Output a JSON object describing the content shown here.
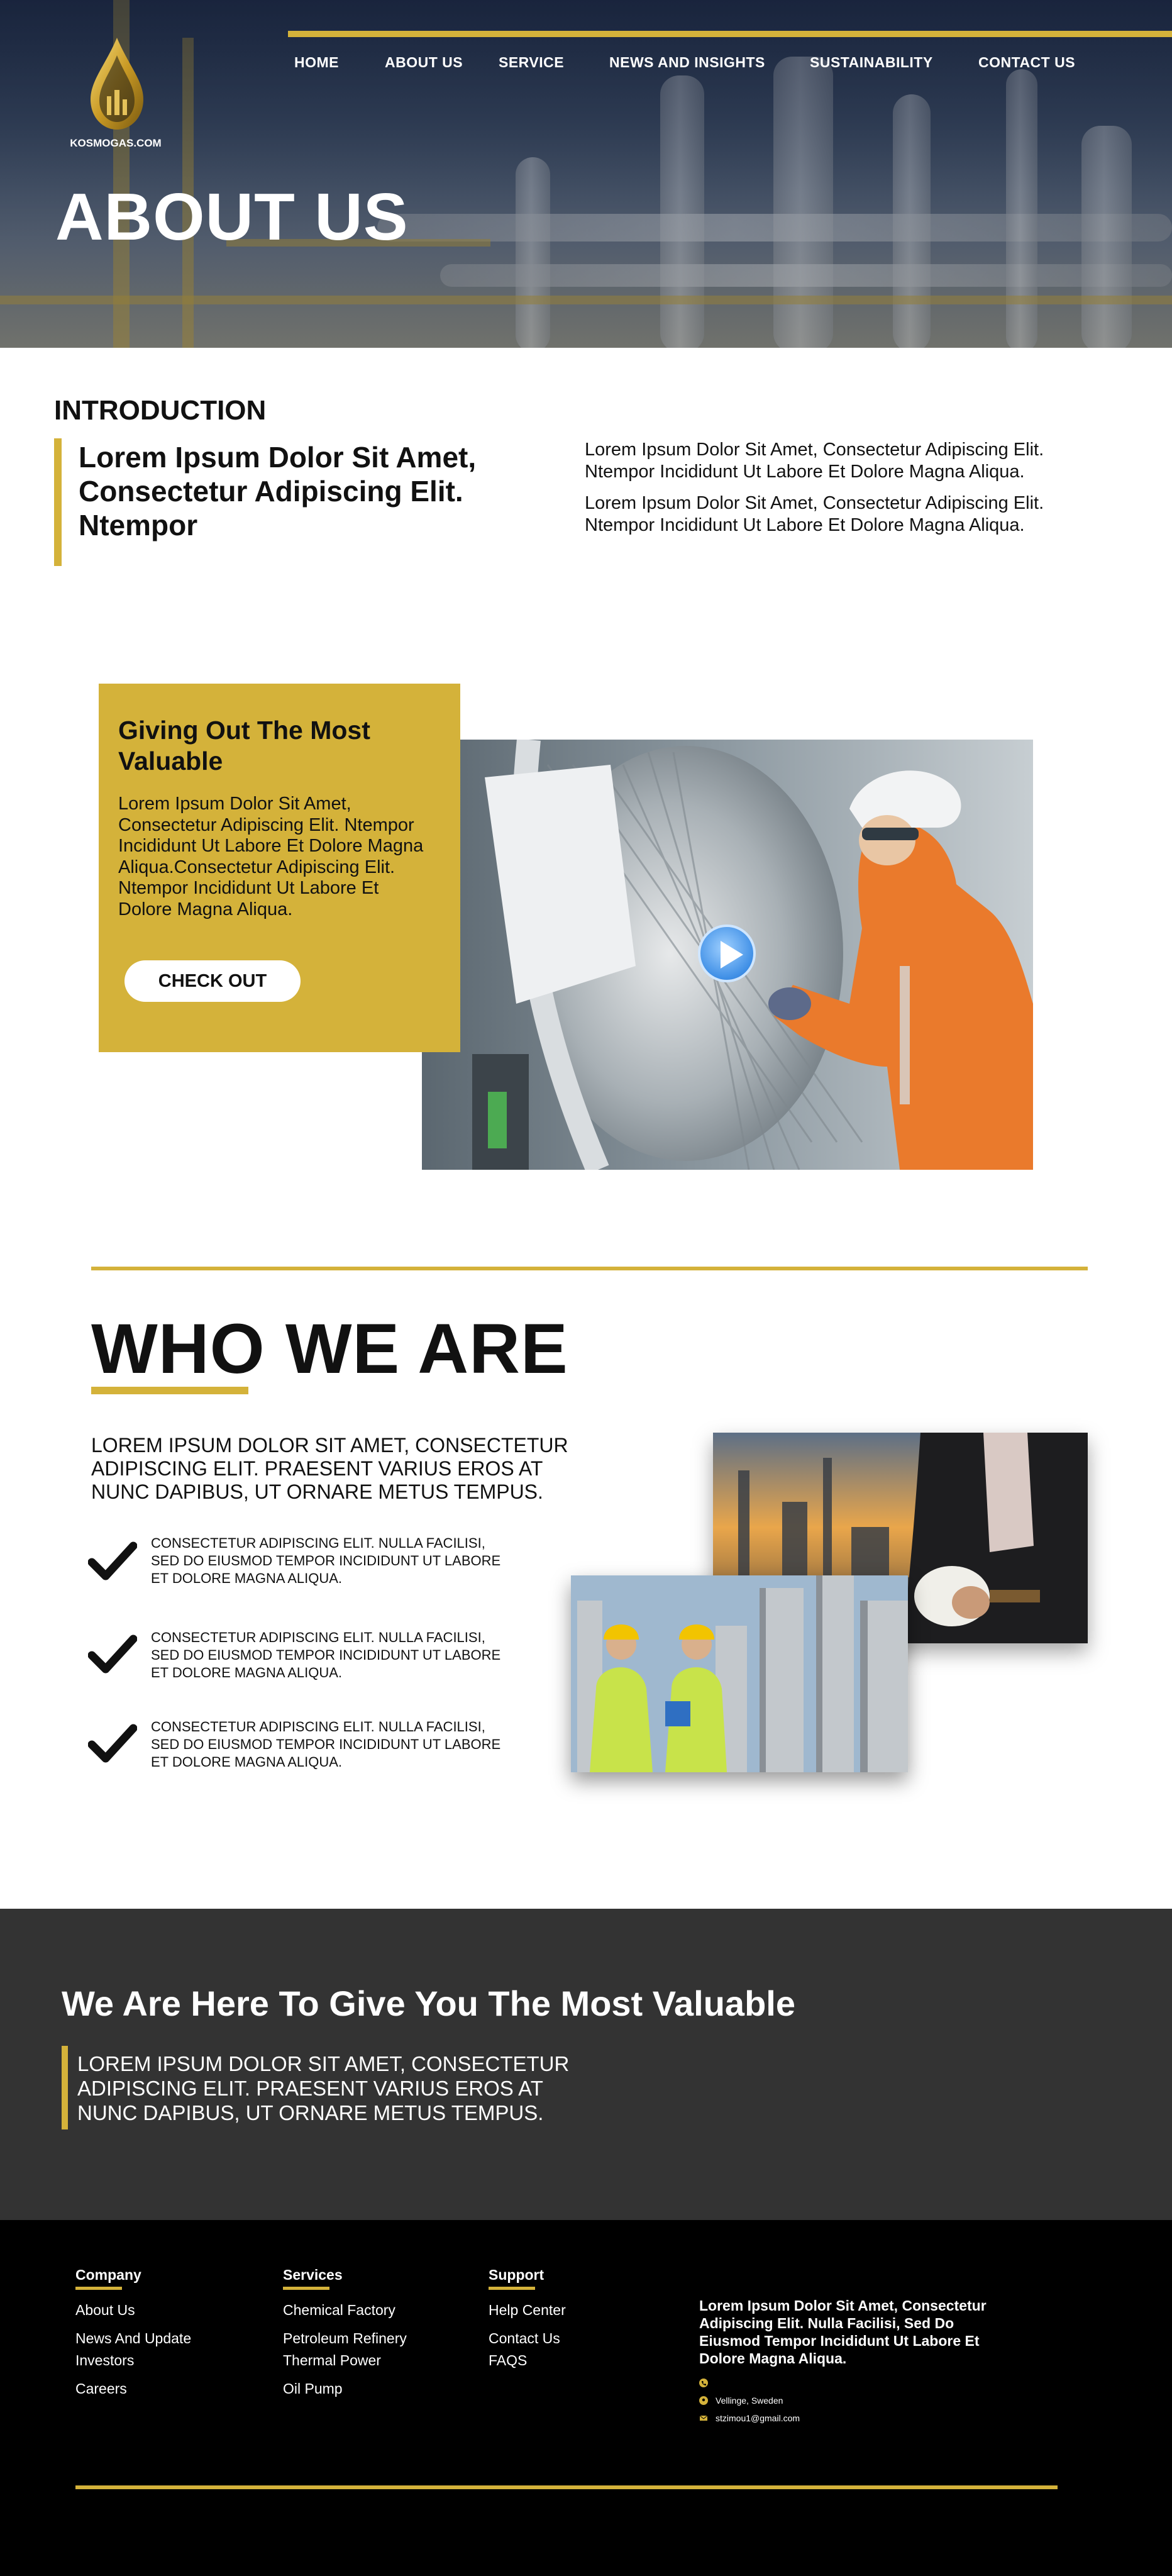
{
  "colors": {
    "accent": "#d4b23a",
    "dark_band": "#333333",
    "footer": "#000000"
  },
  "brand": {
    "name": "KOSMOGAS.COM",
    "tagline": ""
  },
  "nav": {
    "items": [
      "HOME",
      "ABOUT US",
      "SERVICE",
      "NEWS AND INSIGHTS",
      "SUSTAINABILITY",
      "CONTACT US"
    ]
  },
  "hero": {
    "title": "ABOUT US"
  },
  "intro": {
    "heading": "INTRODUCTION",
    "lead": "Lorem Ipsum Dolor Sit Amet, Consectetur Adipiscing Elit. Ntempor",
    "paragraphs": [
      "Lorem Ipsum Dolor Sit Amet, Consectetur Adipiscing Elit. Ntempor Incididunt Ut Labore Et Dolore Magna Aliqua.",
      "Lorem Ipsum Dolor Sit Amet, Consectetur Adipiscing Elit. Ntempor Incididunt Ut Labore Et Dolore Magna Aliqua."
    ]
  },
  "feature": {
    "title": "Giving Out The Most Valuable",
    "body": "Lorem Ipsum Dolor Sit Amet, Consectetur Adipiscing Elit. Ntempor Incididunt Ut Labore Et Dolore Magna Aliqua.Consectetur Adipiscing Elit. Ntempor Incididunt Ut Labore Et Dolore Magna Aliqua.",
    "button": "CHECK OUT",
    "play_icon": "play-icon"
  },
  "who": {
    "title": "WHO WE ARE",
    "lead": "LOREM IPSUM DOLOR SIT AMET, CONSECTETUR ADIPISCING ELIT. PRAESENT VARIUS EROS AT NUNC DAPIBUS, UT ORNARE METUS TEMPUS.",
    "points": [
      "CONSECTETUR ADIPISCING ELIT. NULLA FACILISI, SED DO EIUSMOD TEMPOR INCIDIDUNT UT LABORE ET DOLORE MAGNA ALIQUA.",
      "CONSECTETUR ADIPISCING ELIT. NULLA FACILISI, SED DO EIUSMOD TEMPOR INCIDIDUNT UT LABORE ET DOLORE MAGNA ALIQUA.",
      "CONSECTETUR ADIPISCING ELIT. NULLA FACILISI, SED DO EIUSMOD TEMPOR INCIDIDUNT UT LABORE ET DOLORE MAGNA ALIQUA."
    ]
  },
  "cta": {
    "title": "We Are Here To Give You The Most Valuable",
    "body": "LOREM IPSUM DOLOR SIT AMET, CONSECTETUR ADIPISCING ELIT. PRAESENT VARIUS EROS AT NUNC DAPIBUS, UT ORNARE METUS TEMPUS."
  },
  "footer": {
    "company": {
      "heading": "Company",
      "links": [
        "About Us",
        "News And Update",
        "Investors",
        "Careers"
      ]
    },
    "services": {
      "heading": "Services",
      "links": [
        "Chemical Factory",
        "Petroleum Refinery",
        "Thermal Power",
        "Oil Pump"
      ]
    },
    "support": {
      "heading": "Support",
      "links": [
        "Help Center",
        "Contact Us",
        "FAQS"
      ]
    },
    "about": "Lorem Ipsum Dolor Sit Amet, Consectetur Adipiscing Elit. Nulla Facilisi, Sed Do Eiusmod Tempor Incididunt Ut Labore Et Dolore Magna Aliqua.",
    "contact": {
      "phone": "",
      "address": "Vellinge, Sweden",
      "email": "stzimou1@gmail.com"
    }
  }
}
